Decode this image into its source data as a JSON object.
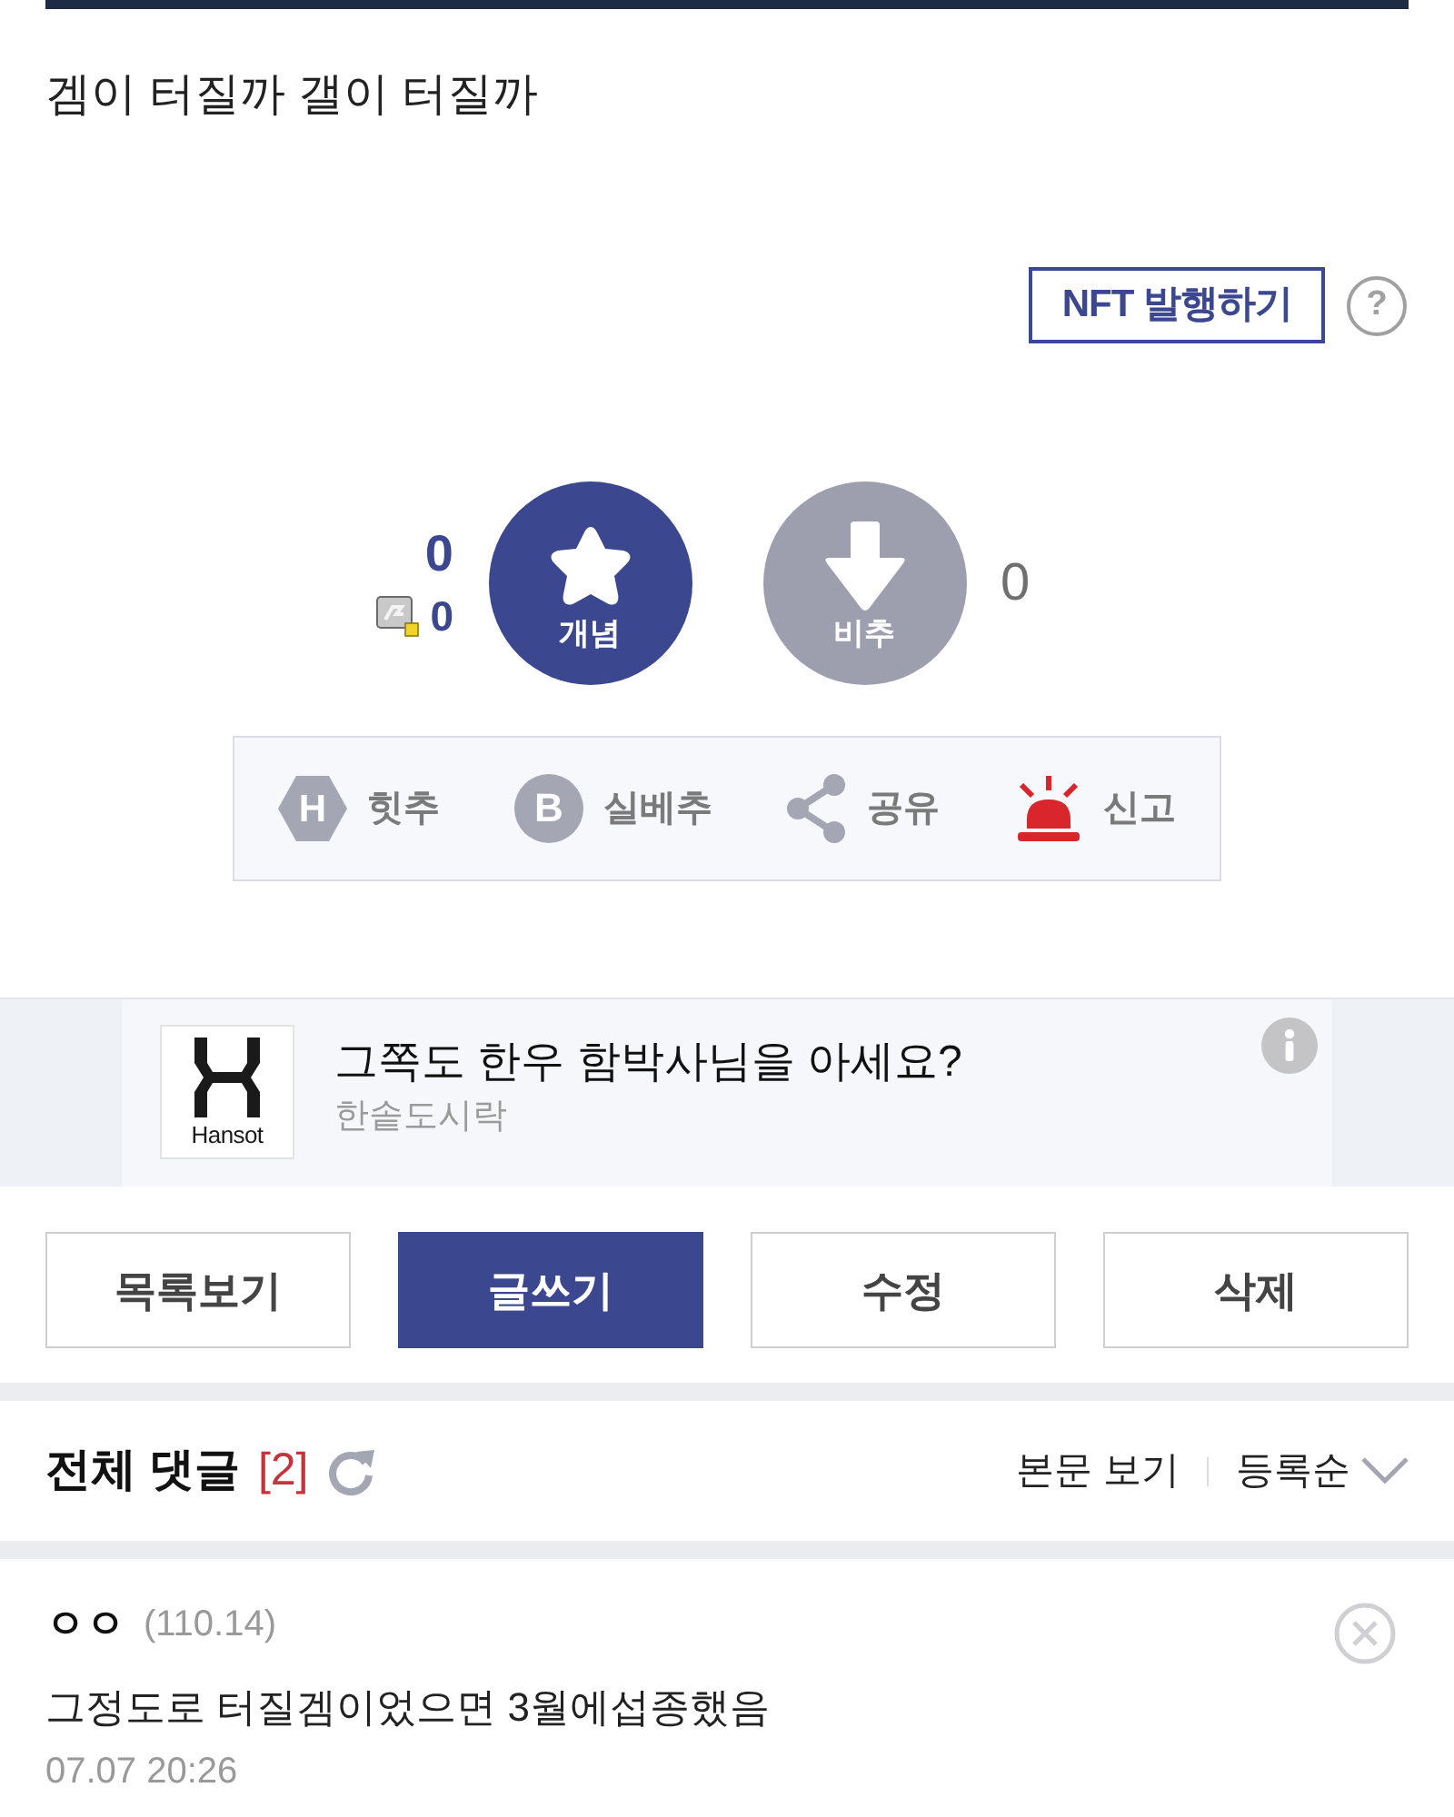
{
  "post": {
    "title": "겜이 터질까 갤이 터질까"
  },
  "nft": {
    "label": "NFT 발행하기",
    "help": "?"
  },
  "votes": {
    "up": {
      "label": "개념",
      "count": "0",
      "fixed_count": "0"
    },
    "down": {
      "label": "비추",
      "count": "0"
    }
  },
  "actions": [
    {
      "kind": "hit",
      "icon_letter": "H",
      "label": "힛추"
    },
    {
      "kind": "silbe",
      "icon_letter": "B",
      "label": "실베추"
    },
    {
      "kind": "share",
      "label": "공유"
    },
    {
      "kind": "report",
      "label": "신고"
    }
  ],
  "ad": {
    "logo_text": "Hansot",
    "title": "그쪽도 한우 함박사님을 아세요?",
    "advertiser": "한솥도시락"
  },
  "buttons": [
    {
      "kind": "default",
      "label": "목록보기"
    },
    {
      "kind": "primary",
      "label": "글쓰기"
    },
    {
      "kind": "default",
      "label": "수정"
    },
    {
      "kind": "default",
      "label": "삭제"
    }
  ],
  "comments": {
    "title": "전체 댓글",
    "count": "[2]",
    "view_body": "본문 보기",
    "sort": "등록순",
    "items": [
      {
        "author": "ㅇㅇ",
        "ip": "(110.14)",
        "text": "그정도로 터질겜이었으면 3월에섭종했음",
        "time": "07.07 20:26"
      }
    ]
  }
}
